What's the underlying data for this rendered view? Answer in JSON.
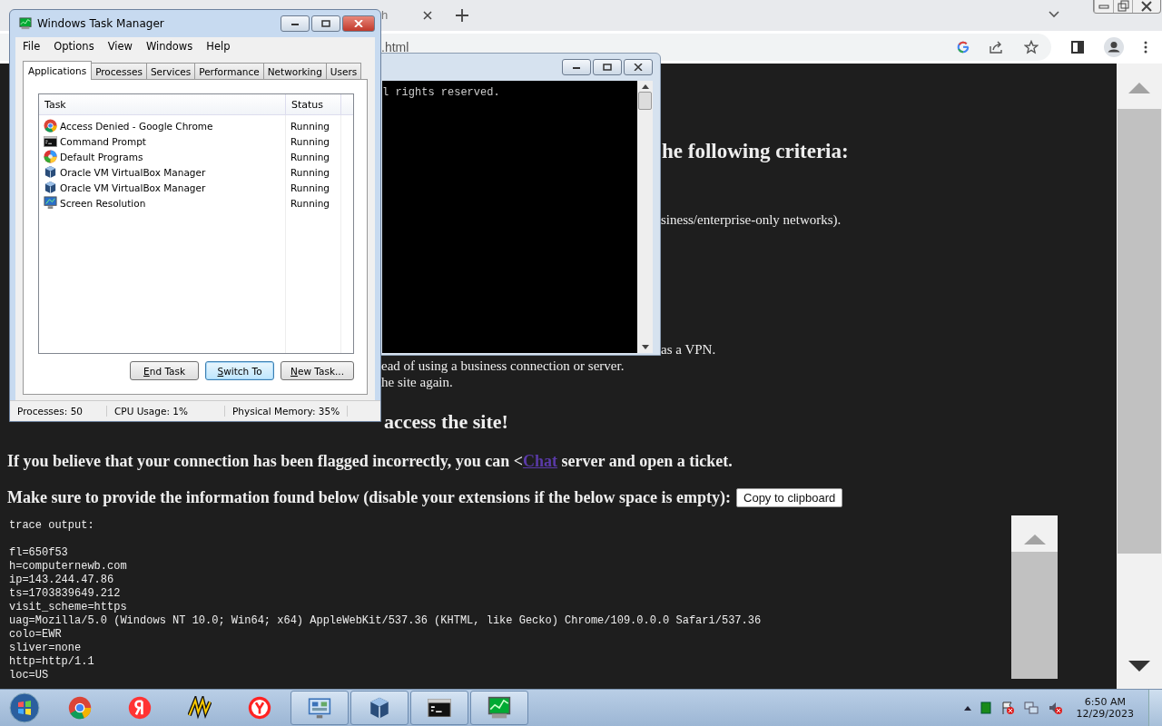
{
  "browser": {
    "tab_fragment": "h",
    "address_fragment": ".html"
  },
  "console_window": {
    "text": "l rights reserved."
  },
  "page": {
    "fragments": [
      {
        "kind": "heading",
        "text": "he following criteria:"
      },
      {
        "kind": "text",
        "text": "siness/enterprise-only networks)."
      },
      {
        "kind": "text",
        "text": "as a VPN."
      },
      {
        "kind": "text",
        "text": "ead of using a business connection or server."
      },
      {
        "kind": "text",
        "text": "he site again."
      }
    ],
    "heading": "access the site!",
    "flag_before": "If you believe that your connection has been flagged incorrectly, you can <",
    "link": "Chat",
    "flag_after": " server and open a ticket.",
    "info_text": "Make sure to provide the information found below (disable your extensions if the below space is empty):",
    "copy_button": "Copy to clipboard",
    "trace_lines": [
      "trace output:",
      "fl=650f53",
      "h=computernewb.com",
      "ip=143.244.47.86",
      "ts=1703839649.212",
      "visit_scheme=https",
      "uag=Mozilla/5.0 (Windows NT 10.0; Win64; x64) AppleWebKit/537.36 (KHTML, like Gecko) Chrome/109.0.0.0 Safari/537.36",
      "colo=EWR",
      "sliver=none",
      "http=http/1.1",
      "loc=US"
    ]
  },
  "task_manager": {
    "title": "Windows Task Manager",
    "menu": [
      "File",
      "Options",
      "View",
      "Windows",
      "Help"
    ],
    "tabs": [
      {
        "label": "Applications",
        "selected": true
      },
      {
        "label": "Processes",
        "selected": false
      },
      {
        "label": "Services",
        "selected": false
      },
      {
        "label": "Performance",
        "selected": false
      },
      {
        "label": "Networking",
        "selected": false
      },
      {
        "label": "Users",
        "selected": false
      }
    ],
    "columns": [
      "Task",
      "Status"
    ],
    "rows": [
      {
        "kind": "chrome",
        "task": "Access Denied - Google Chrome",
        "status": "Running"
      },
      {
        "kind": "console",
        "task": "Command Prompt",
        "status": "Running"
      },
      {
        "kind": "programs",
        "task": "Default Programs",
        "status": "Running"
      },
      {
        "kind": "virtualbox",
        "task": "Oracle VM VirtualBox Manager",
        "status": "Running"
      },
      {
        "kind": "virtualbox",
        "task": "Oracle VM VirtualBox Manager",
        "status": "Running"
      },
      {
        "kind": "display",
        "task": "Screen Resolution",
        "status": "Running"
      }
    ],
    "buttons": [
      {
        "label": "End Task",
        "default": false
      },
      {
        "label": "Switch To",
        "default": true
      },
      {
        "label": "New Task...",
        "default": false
      }
    ],
    "status_bar": [
      "Processes: 50",
      "CPU Usage: 1%",
      "Physical Memory: 35%"
    ]
  },
  "taskbar": {
    "items": [
      {
        "kind": "chrome",
        "running": false
      },
      {
        "kind": "yandex-letter",
        "running": false
      },
      {
        "kind": "squiggle",
        "running": false
      },
      {
        "kind": "yandex-browser",
        "running": false
      },
      {
        "kind": "control-panel",
        "running": true
      },
      {
        "kind": "virtualbox",
        "running": true
      },
      {
        "kind": "console",
        "running": true
      },
      {
        "kind": "task-manager",
        "running": true
      }
    ],
    "time": "6:50 AM",
    "date": "12/29/2023"
  }
}
